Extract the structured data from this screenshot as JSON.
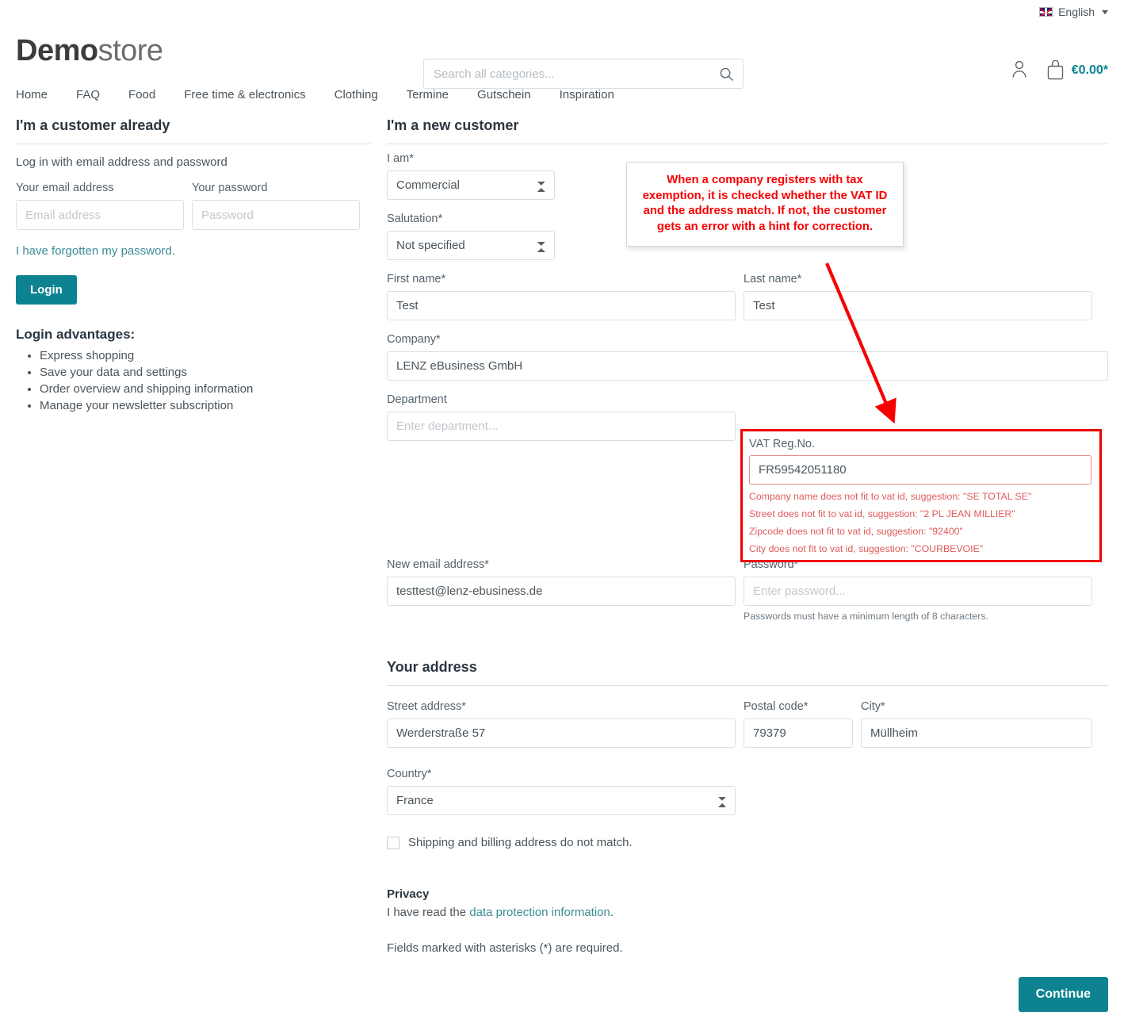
{
  "topbar": {
    "language": "English",
    "flag_icon": "uk-flag-icon",
    "caret_icon": "chevron-down-icon"
  },
  "header": {
    "logo_bold": "Demo",
    "logo_light": "store",
    "search": {
      "placeholder": "Search all categories...",
      "value": "",
      "icon": "search-icon"
    },
    "account_icon": "user-icon",
    "cart_icon": "bag-icon",
    "cart_amount": "€0.00*"
  },
  "nav": {
    "items": [
      {
        "label": "Home"
      },
      {
        "label": "FAQ"
      },
      {
        "label": "Food"
      },
      {
        "label": "Free time & electronics"
      },
      {
        "label": "Clothing"
      },
      {
        "label": "Termine"
      },
      {
        "label": "Gutschein"
      },
      {
        "label": "Inspiration"
      }
    ]
  },
  "login": {
    "title": "I'm a customer already",
    "subtitle": "Log in with email address and password",
    "email_label": "Your email address",
    "email_placeholder": "Email address",
    "email_value": "",
    "password_label": "Your password",
    "password_placeholder": "Password",
    "password_value": "",
    "forgot_link": "I have forgotten my password.",
    "login_button": "Login",
    "advantages_title": "Login advantages:",
    "advantages": [
      "Express shopping",
      "Save your data and settings",
      "Order overview and shipping information",
      "Manage your newsletter subscription"
    ]
  },
  "register": {
    "title": "I'm a new customer",
    "i_am_label": "I am*",
    "i_am_value": "Commercial",
    "salutation_label": "Salutation*",
    "salutation_value": "Not specified",
    "first_name_label": "First name*",
    "first_name_value": "Test",
    "last_name_label": "Last name*",
    "last_name_value": "Test",
    "company_label": "Company*",
    "company_value": "LENZ eBusiness GmbH",
    "department_label": "Department",
    "department_placeholder": "Enter department...",
    "department_value": "",
    "email_label": "New email address*",
    "email_value": "testtest@lenz-ebusiness.de",
    "password_label": "Password*",
    "password_placeholder": "Enter password...",
    "password_value": "",
    "password_hint": "Passwords must have a minimum length of 8 characters."
  },
  "vat": {
    "label": "VAT Reg.No.",
    "value": "FR59542051180",
    "errors": [
      "Company name does not fit to vat id, suggestion: \"SE TOTAL SE\"",
      "Street does not fit to vat id, suggestion: \"2 PL JEAN MILLIER\"",
      "Zipcode does not fit to vat id, suggestion: \"92400\"",
      "City does not fit to vat id, suggestion: \"COURBEVOIE\""
    ],
    "border_color": "#f00000",
    "text_color": "#e05a5a"
  },
  "callout": {
    "text": "When a company registers with tax exemption, it is checked whether the VAT ID and the address match. If not, the customer gets an error with a hint for correction.",
    "color": "#f80000"
  },
  "address": {
    "title": "Your address",
    "street_label": "Street address*",
    "street_value": "Werderstraße 57",
    "postal_label": "Postal code*",
    "postal_value": "79379",
    "city_label": "City*",
    "city_value": "Müllheim",
    "country_label": "Country*",
    "country_value": "France",
    "shipping_checkbox_label": "Shipping and billing address do not match.",
    "shipping_checkbox_checked": false
  },
  "privacy": {
    "title": "Privacy",
    "text_before": "I have read the ",
    "link": "data protection information",
    "text_after": ".",
    "required_note": "Fields marked with asterisks (*) are required."
  },
  "footer": {
    "continue_button": "Continue"
  },
  "colors": {
    "accent": "#0d8391",
    "link": "#3b8c96",
    "error": "#f00000",
    "text": "#4a545b"
  }
}
